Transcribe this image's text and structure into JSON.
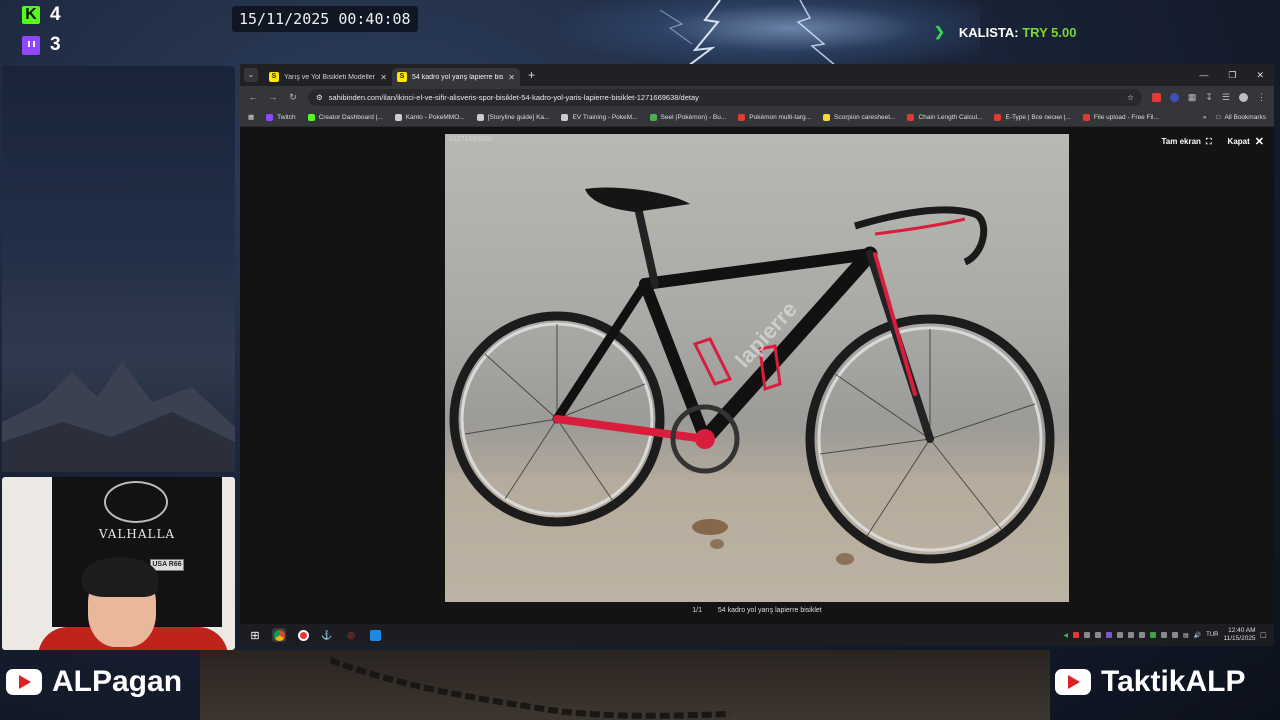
{
  "overlay": {
    "kick_count": "4",
    "twitch_count": "3",
    "clock": "15/11/2025 00:40:08",
    "alert_name": "KALISTA:",
    "alert_amount": "TRY 5.00",
    "webcam_flag_text": "VALHALLA",
    "webcam_plate_text": "USA R66",
    "channel_left": "ALPagan",
    "channel_right": "TaktikALP"
  },
  "browser": {
    "tabs": [
      {
        "label": "Yarış ve Yol Bisikleti Modelleri",
        "favicon": "S",
        "active": false
      },
      {
        "label": "54 kadro yol yarış lapierre bisik",
        "favicon": "S",
        "active": true
      }
    ],
    "url": "sahibinden.com/ilan/ikinci-el-ve-sifir-alisveris-spor-bisiklet-54-kadro-yol-yaris-lapierre-bisiklet-1271669638/detay",
    "bookmarks": [
      {
        "label": "Twitch",
        "color": "#9146ff"
      },
      {
        "label": "Creator Dashboard |...",
        "color": "#53fc18"
      },
      {
        "label": "Kanto - PokeMMO...",
        "color": "#cccccc"
      },
      {
        "label": "[Storyline guide] Ka...",
        "color": "#cccccc"
      },
      {
        "label": "EV Training - PokeM...",
        "color": "#cccccc"
      },
      {
        "label": "Seel (Pokémon) - Bu...",
        "color": "#4caf50"
      },
      {
        "label": "Pokémon multi-targ...",
        "color": "#e53935"
      },
      {
        "label": "Scorpion caresheet...",
        "color": "#fdd835"
      },
      {
        "label": "Chain Length Calcul...",
        "color": "#e53935"
      },
      {
        "label": "E-Type | Все песни |...",
        "color": "#e53935"
      },
      {
        "label": "File upload - Free Fil...",
        "color": "#e53935"
      }
    ],
    "all_bookmarks": "All Bookmarks"
  },
  "viewer": {
    "fullscreen_label": "Tam ekran",
    "close_label": "Kapat",
    "watermark": "#1271669638",
    "counter": "1/1",
    "caption": "54 kadro yol yarış lapierre bisiklet"
  },
  "taskbar": {
    "time": "12:40 AM",
    "date": "11/15/2025",
    "lang": "TUR"
  },
  "colors": {
    "kick": "#53fc18",
    "twitch": "#9146ff",
    "alert_amount": "#7cd633",
    "bike_red": "#d81e3c"
  }
}
